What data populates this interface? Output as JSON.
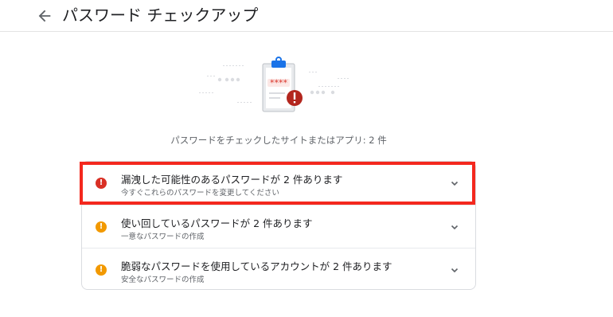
{
  "header": {
    "back_icon": "arrow-back-icon",
    "title": "パスワード チェックアップ"
  },
  "illustration": {
    "icon": "clipboard-password-warning-illustration",
    "masked_password": "****"
  },
  "summary": "パスワードをチェックしたサイトまたはアプリ: 2 件",
  "issues": [
    {
      "title": "漏洩した可能性のあるパスワードが 2 件あります",
      "subtitle": "今すぐこれらのパスワードを変更してください",
      "severity": "critical",
      "icon": "error-icon",
      "icon_color": "#d93025",
      "highlighted": true
    },
    {
      "title": "使い回しているパスワードが 2 件あります",
      "subtitle": "一意なパスワードの作成",
      "severity": "warning",
      "icon": "warning-icon",
      "icon_color": "#f29900",
      "highlighted": false
    },
    {
      "title": "脆弱なパスワードを使用しているアカウントが 2 件あります",
      "subtitle": "安全なパスワードの作成",
      "severity": "warning",
      "icon": "warning-icon",
      "icon_color": "#f29900",
      "highlighted": false
    }
  ],
  "colors": {
    "highlight_border": "#f4281e",
    "clip": "#1a73e8",
    "error": "#d93025",
    "warning": "#f29900"
  }
}
